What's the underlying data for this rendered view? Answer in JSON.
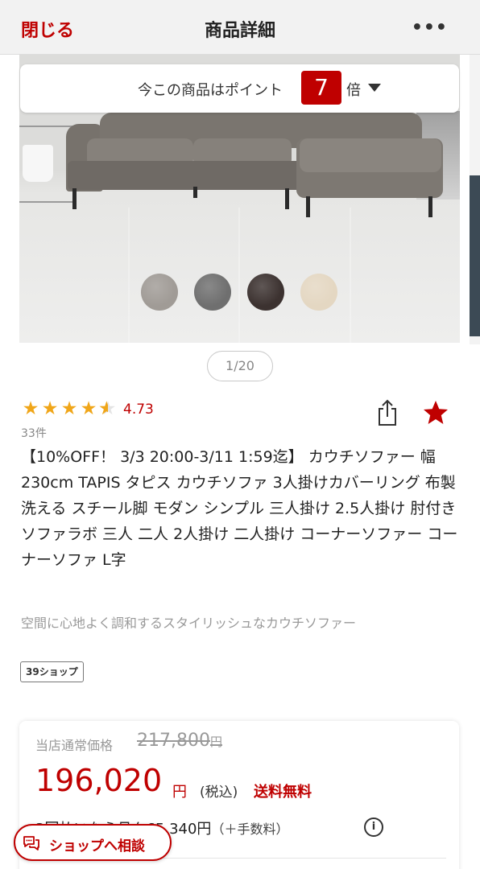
{
  "header": {
    "close_label": "閉じる",
    "title": "商品詳細",
    "more_label": "•••"
  },
  "point_banner": {
    "text": "今この商品はポイント",
    "multiplier": "7",
    "suffix": "倍"
  },
  "gallery": {
    "pager": "1/20",
    "swatches": [
      "#a09b96",
      "#6f6f6f",
      "#3c3230",
      "#e4d7c2"
    ]
  },
  "rating": {
    "stars": 4.5,
    "score": "4.73",
    "count": "33件"
  },
  "product": {
    "title": "【10%OFF！ 3/3 20:00-3/11 1:59迄】 カウチソファー 幅230cm TAPIS タピス カウチソファ 3人掛けカバーリング 布製 洗える スチール脚 モダン シンプル 三人掛け 2.5人掛け 肘付き ソファラボ 三人 二人 2人掛け 二人掛け コーナーソファー コーナーソファ L字",
    "catch_copy": "空間に心地よく調和するスタイリッシュなカウチソファー",
    "shop_badge": "39ショップ"
  },
  "price": {
    "regular_label": "当店通常価格",
    "regular_value": "217,800",
    "regular_yen": "円",
    "value": "196,020",
    "yen": "円",
    "tax": "(税込)",
    "shipping": "送料無料",
    "installment": "3回払いなら月々65,340円",
    "installment_fee": "（＋手数料）",
    "info_icon": "i"
  },
  "consult": {
    "label": "ショップへ相談"
  },
  "colors": {
    "accent": "#bf0000",
    "star": "#f0a619"
  }
}
